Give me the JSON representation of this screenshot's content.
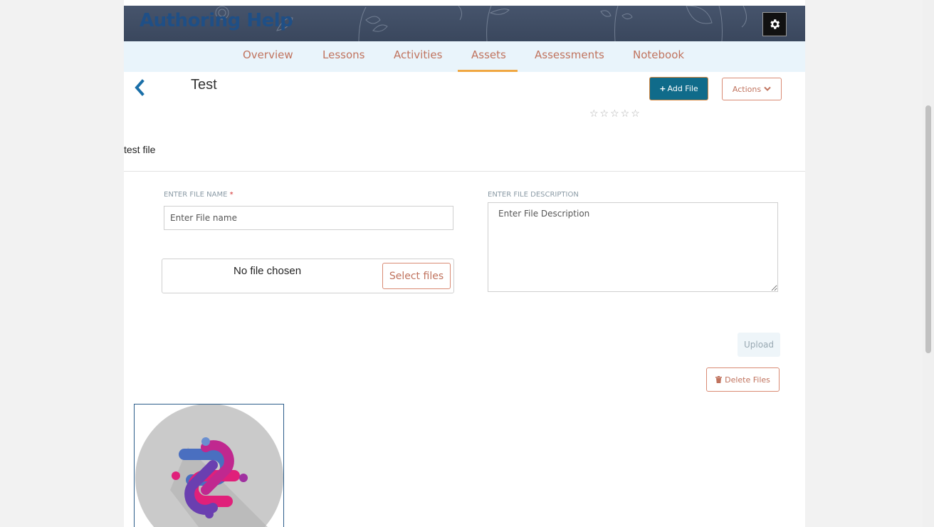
{
  "header": {
    "title": "Authoring Help"
  },
  "nav": {
    "items": [
      {
        "label": "Overview"
      },
      {
        "label": "Lessons"
      },
      {
        "label": "Activities"
      },
      {
        "label": "Assets",
        "active": true
      },
      {
        "label": "Assessments"
      },
      {
        "label": "Notebook"
      }
    ]
  },
  "asset": {
    "title": "Test",
    "rating": {
      "value": 0,
      "max": 5,
      "stars": "☆☆☆☆☆"
    },
    "file_title": "test file"
  },
  "toolbar": {
    "add_file_label": "Add File",
    "actions_label": "Actions"
  },
  "form": {
    "file_name_label": "ENTER FILE NAME",
    "file_name_required_mark": "*",
    "file_name_placeholder": "Enter File name",
    "file_desc_label": "ENTER FILE DESCRIPTION",
    "file_desc_placeholder": "Enter File Description",
    "file_status": "No file chosen",
    "select_files_label": "Select files",
    "upload_label": "Upload",
    "delete_files_label": "Delete Files"
  },
  "colors": {
    "accent": "#c0735e",
    "primary": "#106b8a",
    "nav_bg": "#e9f4fb",
    "active_underline": "#f0a742",
    "title_blue": "#1f4f86"
  }
}
